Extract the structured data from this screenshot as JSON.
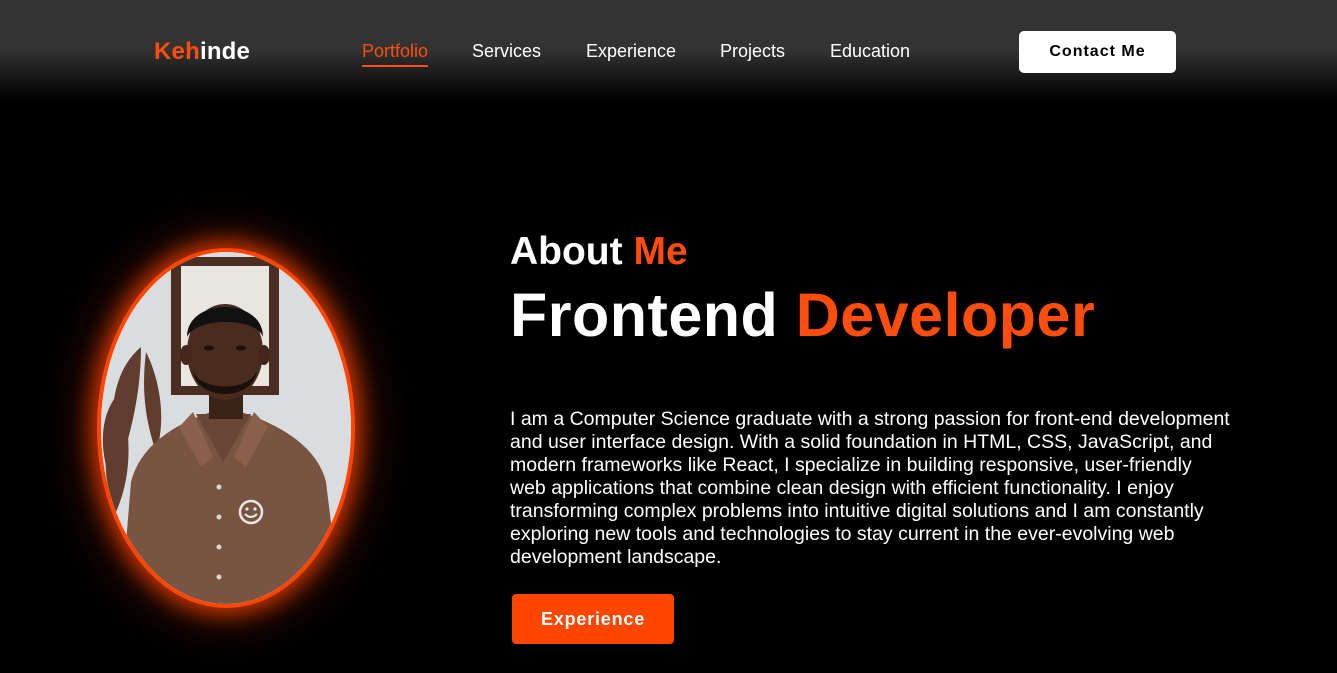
{
  "header": {
    "logo": {
      "accent": "Keh",
      "rest": "inde"
    },
    "nav": [
      {
        "label": "Portfolio",
        "active": true
      },
      {
        "label": "Services",
        "active": false
      },
      {
        "label": "Experience",
        "active": false
      },
      {
        "label": "Projects",
        "active": false
      },
      {
        "label": "Education",
        "active": false
      }
    ],
    "contact_button": "Contact Me"
  },
  "about": {
    "heading_white": "About ",
    "heading_accent": "Me",
    "role_white": "Frontend ",
    "role_accent": "Developer",
    "bio": "I am a Computer Science graduate with a strong passion for front-end development and user interface design. With a solid foundation in HTML, CSS, JavaScript, and modern frameworks like React, I specialize in building responsive, user-friendly web applications that combine clean design with efficient functionality. I enjoy transforming complex problems into intuitive digital solutions and I am constantly exploring new tools and technologies to stay current in the ever-evolving web development landscape.",
    "cta_button": "Experience"
  },
  "colors": {
    "accent": "#ff4d0d",
    "background": "#000000",
    "header_bg": "#333333"
  }
}
